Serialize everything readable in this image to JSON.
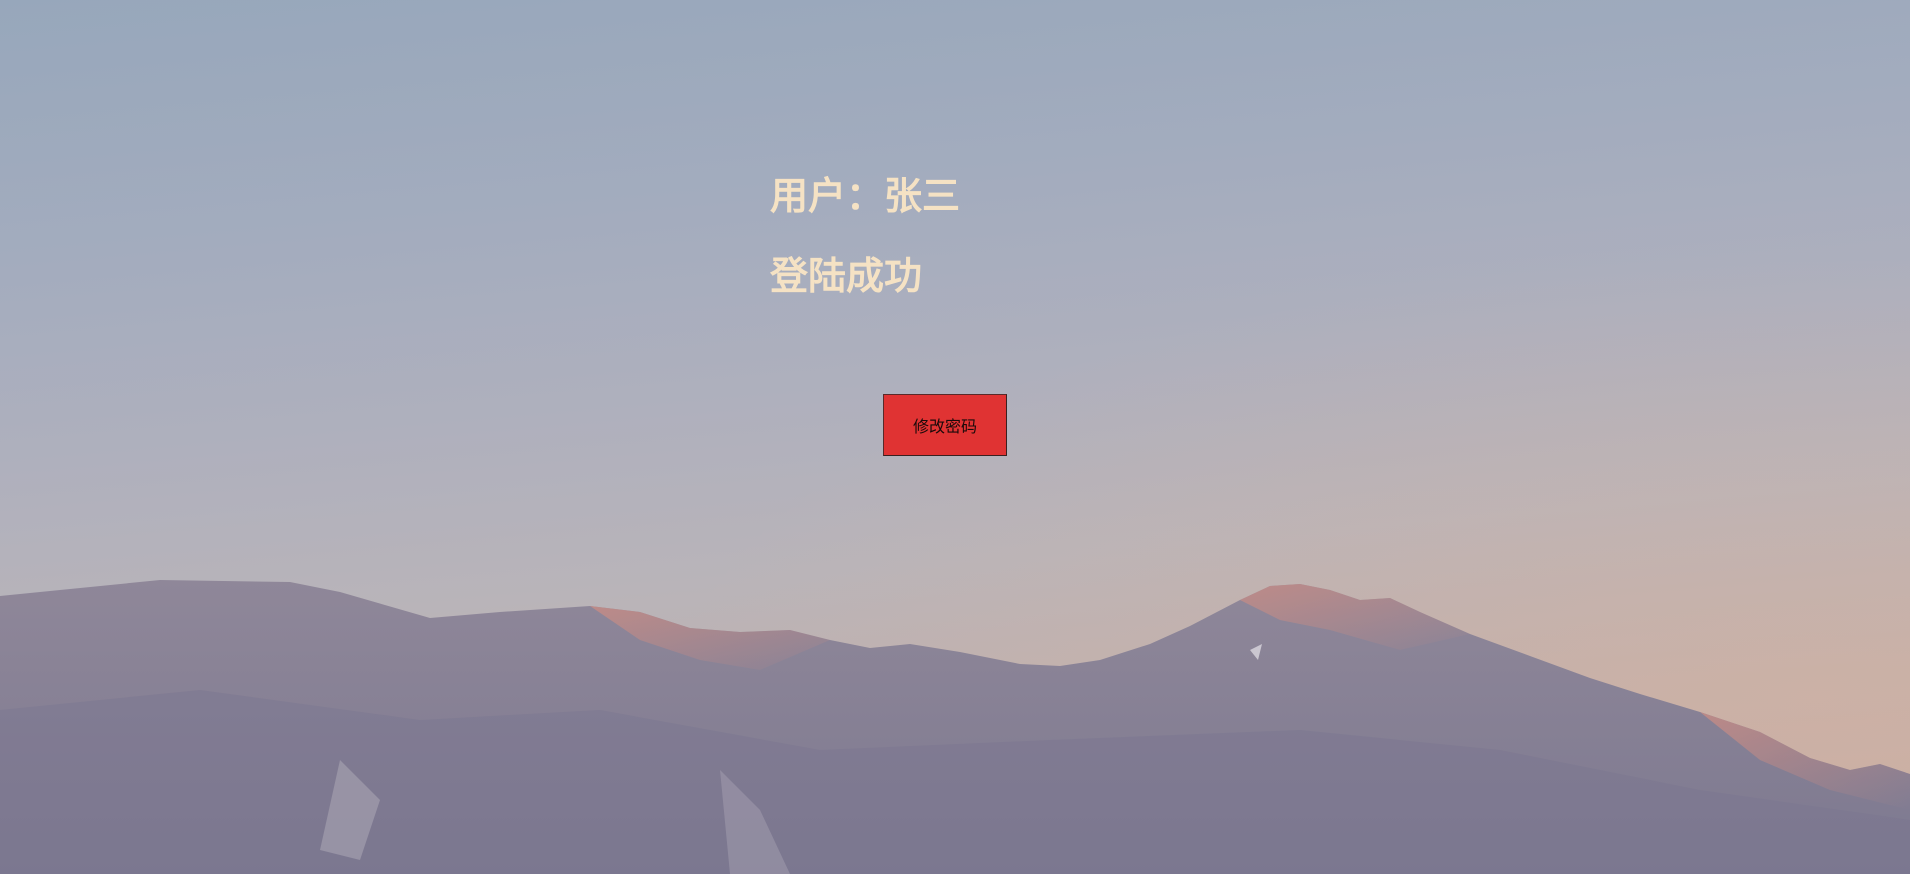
{
  "user": {
    "label": "用户：",
    "name": "张三"
  },
  "status_text": "登陆成功",
  "change_password_button": "修改密码",
  "colors": {
    "text": "#f5e2c4",
    "button": "#e03333"
  }
}
